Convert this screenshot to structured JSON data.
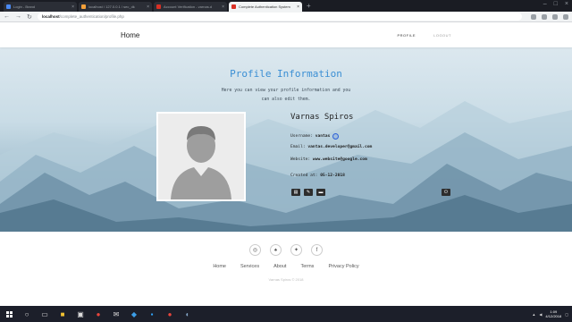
{
  "browser": {
    "tabs": [
      {
        "title": "Login - Brand",
        "color": "#4a8af4",
        "active": false
      },
      {
        "title": "localhost / 127.0.0.1 / sec_dk",
        "color": "#f4a03a",
        "active": false
      },
      {
        "title": "Account Verification - varnas.d",
        "color": "#d93025",
        "active": false
      },
      {
        "title": "Complete Authentication System",
        "color": "#d93025",
        "active": true
      }
    ],
    "url_host": "localhost",
    "url_path": "/complete_authentication/profile.php"
  },
  "site": {
    "brand": "Home",
    "nav": {
      "profile": "PROFILE",
      "logout": "LOGOUT"
    }
  },
  "profile": {
    "title": "Profile Information",
    "subtitle": "Here you can view your profile information and you can also edit them.",
    "name": "Varnas Spiros",
    "username_label": "Username:",
    "username": "vantas",
    "email_label": "Email:",
    "email": "vantas.developer@gmail.com",
    "website_label": "Website:",
    "website": "www.website@google.com",
    "created_label": "Created at:",
    "created": "05-12-2018"
  },
  "footer": {
    "links": [
      "Home",
      "Services",
      "About",
      "Terms",
      "Privacy Policy"
    ],
    "copyright": "Varnas Spiros © 2018"
  },
  "taskbar": {
    "time": "1:09",
    "date": "4/12/2018"
  }
}
